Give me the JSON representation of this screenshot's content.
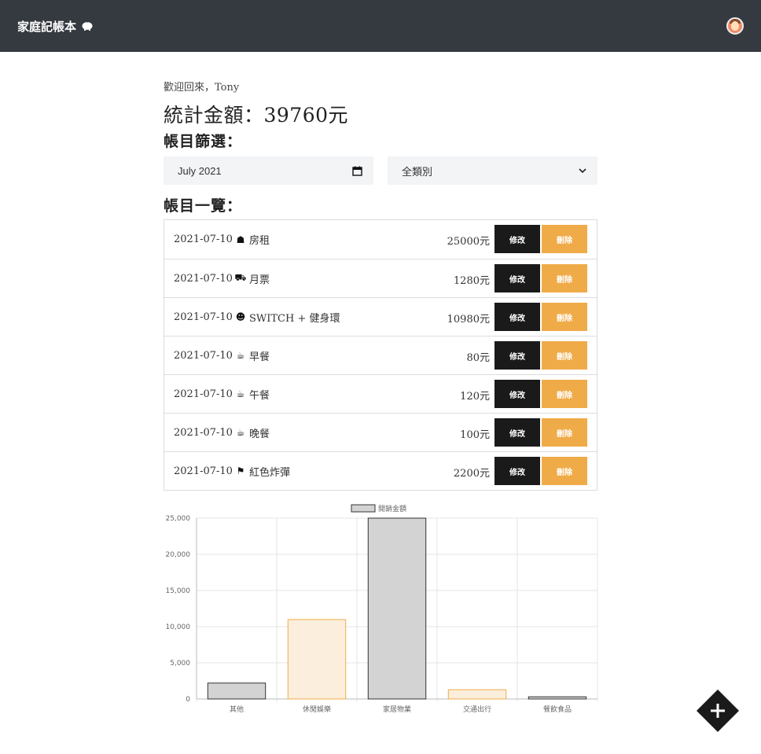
{
  "app": {
    "brand": "家庭記帳本",
    "brand_icon": "piggy-bank-icon",
    "avatar_icon": "user-avatar"
  },
  "main": {
    "welcome": "歡迎回來，Tony",
    "total": "統計金額：39760元",
    "filter_title": "帳目篩選：",
    "list_title": "帳目一覽："
  },
  "filters": {
    "month_value": "July 2021",
    "category_value": "全類別"
  },
  "buttons": {
    "edit_label": "修改",
    "delete_label": "刪除"
  },
  "entries": [
    {
      "date": "2021-07-10",
      "icon": "home-icon",
      "glyph": "☗",
      "item": "房租",
      "amount": "25000元"
    },
    {
      "date": "2021-07-10",
      "icon": "truck-icon",
      "glyph": "⛟",
      "item": "月票",
      "amount": "1280元"
    },
    {
      "date": "2021-07-10",
      "icon": "smile-icon",
      "glyph": "☻",
      "item": "SWITCH + 健身環",
      "amount": "10980元"
    },
    {
      "date": "2021-07-10",
      "icon": "cup-icon",
      "glyph": "☕",
      "item": "早餐",
      "amount": "80元"
    },
    {
      "date": "2021-07-10",
      "icon": "cup-icon",
      "glyph": "☕",
      "item": "午餐",
      "amount": "120元"
    },
    {
      "date": "2021-07-10",
      "icon": "cup-icon",
      "glyph": "☕",
      "item": "晚餐",
      "amount": "100元"
    },
    {
      "date": "2021-07-10",
      "icon": "flag-icon",
      "glyph": "⚑",
      "item": "紅色炸彈",
      "amount": "2200元"
    }
  ],
  "chart_data": {
    "type": "bar",
    "categories": [
      "其他",
      "休閒娛樂",
      "家居物業",
      "交通出行",
      "餐飲食品"
    ],
    "series": [
      {
        "name": "開銷金額",
        "values": [
          2200,
          10980,
          25000,
          1280,
          300
        ]
      }
    ],
    "ylim": [
      0,
      25000
    ],
    "yticks": [
      "0",
      "5,000",
      "10,000",
      "15,000",
      "20,000",
      "25,000"
    ],
    "ytick_values": [
      0,
      5000,
      10000,
      15000,
      20000,
      25000
    ],
    "legend": "top",
    "grid": true,
    "colors": {
      "fill": [
        "#d3d3d3",
        "#fbeedc",
        "#d3d3d3",
        "#fbeedc",
        "#d3d3d3"
      ],
      "stroke": [
        "#333333",
        "#f0ab49",
        "#333333",
        "#f0ab49",
        "#333333"
      ]
    }
  },
  "fab": {
    "icon": "plus-icon"
  }
}
